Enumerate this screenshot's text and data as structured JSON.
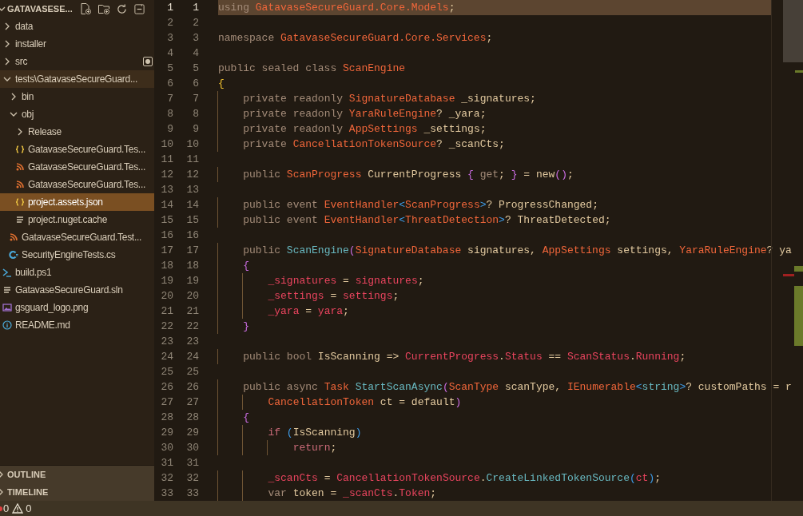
{
  "explorer": {
    "title": "GATAVASESE...",
    "expanded": true,
    "tree": [
      {
        "label": "data",
        "kind": "folder",
        "expanded": false,
        "selected": false,
        "hovered": false,
        "badge": false
      },
      {
        "label": "installer",
        "kind": "folder",
        "expanded": false,
        "selected": false,
        "hovered": false,
        "badge": false
      },
      {
        "label": "src",
        "kind": "folder",
        "expanded": false,
        "selected": false,
        "hovered": false,
        "badge": true
      },
      {
        "label": "tests\\GatavaseSecureGuard...",
        "kind": "folder",
        "expanded": true,
        "selected": false,
        "hovered": true,
        "badge": false,
        "children": [
          {
            "label": "bin",
            "kind": "folder",
            "expanded": false,
            "selected": false,
            "hovered": false,
            "badge": false
          },
          {
            "label": "obj",
            "kind": "folder",
            "expanded": true,
            "selected": false,
            "hovered": false,
            "badge": false,
            "children": [
              {
                "label": "Release",
                "kind": "folder",
                "expanded": false,
                "selected": false,
                "hovered": false,
                "badge": false
              },
              {
                "label": "GatavaseSecureGuard.Tes...",
                "kind": "json",
                "selected": false,
                "hovered": false,
                "badge": false
              },
              {
                "label": "GatavaseSecureGuard.Tes...",
                "kind": "feed",
                "selected": false,
                "hovered": false,
                "badge": false
              },
              {
                "label": "GatavaseSecureGuard.Tes...",
                "kind": "feed",
                "selected": false,
                "hovered": false,
                "badge": false
              },
              {
                "label": "project.assets.json",
                "kind": "json",
                "selected": true,
                "hovered": false,
                "badge": false
              },
              {
                "label": "project.nuget.cache",
                "kind": "text",
                "selected": false,
                "hovered": false,
                "badge": false
              }
            ]
          },
          {
            "label": "GatavaseSecureGuard.Test...",
            "kind": "feed",
            "selected": false,
            "hovered": false,
            "badge": false
          },
          {
            "label": "SecurityEngineTests.cs",
            "kind": "csharp",
            "selected": false,
            "hovered": false,
            "badge": false
          }
        ]
      },
      {
        "label": "build.ps1",
        "kind": "shell",
        "selected": false,
        "hovered": false,
        "badge": false
      },
      {
        "label": "GatavaseSecureGuard.sln",
        "kind": "text",
        "selected": false,
        "hovered": false,
        "badge": false
      },
      {
        "label": "gsguard_logo.png",
        "kind": "image",
        "selected": false,
        "hovered": false,
        "badge": false
      },
      {
        "label": "README.md",
        "kind": "info",
        "selected": false,
        "hovered": false,
        "badge": false
      }
    ]
  },
  "panels": [
    {
      "label": "OUTLINE",
      "expanded": false
    },
    {
      "label": "TIMELINE",
      "expanded": false
    }
  ],
  "editor": {
    "lines": [
      {
        "n": "1",
        "n2": "1",
        "current": true,
        "parts": [
          {
            "kind": "keyword",
            "text": "using "
          },
          {
            "kind": "type",
            "text": "GatavaseSecureGuard.Core.Models"
          },
          {
            "kind": "plain",
            "text": ";"
          }
        ]
      },
      {
        "n": "2",
        "n2": "2",
        "current": false
      },
      {
        "n": "3",
        "n2": "3",
        "current": false,
        "parts": [
          {
            "kind": "keyword",
            "text": "namespace "
          },
          {
            "kind": "type",
            "text": "GatavaseSecureGuard.Core.Services"
          },
          {
            "kind": "plain",
            "text": ";"
          }
        ]
      },
      {
        "n": "4",
        "n2": "4",
        "current": false
      },
      {
        "n": "5",
        "n2": "5",
        "current": false,
        "parts": [
          {
            "kind": "keyword",
            "text": "public sealed class "
          },
          {
            "kind": "type",
            "text": "ScanEngine"
          }
        ]
      },
      {
        "n": "6",
        "n2": "6",
        "current": false,
        "parts": [
          {
            "kind": "brace1",
            "text": "{"
          }
        ]
      },
      {
        "n": "7",
        "n2": "7",
        "current": false,
        "parts": [
          {
            "kind": "keyword",
            "text": "    private readonly "
          },
          {
            "kind": "type",
            "text": "SignatureDatabase"
          },
          {
            "kind": "plain",
            "text": " _signatures;"
          }
        ]
      },
      {
        "n": "8",
        "n2": "8",
        "current": false,
        "parts": [
          {
            "kind": "keyword",
            "text": "    private readonly "
          },
          {
            "kind": "type",
            "text": "YaraRuleEngine"
          },
          {
            "kind": "plain",
            "text": "? _yara;"
          }
        ]
      },
      {
        "n": "9",
        "n2": "9",
        "current": false,
        "parts": [
          {
            "kind": "keyword",
            "text": "    private readonly "
          },
          {
            "kind": "type",
            "text": "AppSettings"
          },
          {
            "kind": "plain",
            "text": " _settings;"
          }
        ]
      },
      {
        "n": "10",
        "n2": "10",
        "current": false,
        "parts": [
          {
            "kind": "keyword",
            "text": "    private "
          },
          {
            "kind": "type",
            "text": "CancellationTokenSource"
          },
          {
            "kind": "plain",
            "text": "? _scanCts;"
          }
        ]
      },
      {
        "n": "11",
        "n2": "11",
        "current": false
      },
      {
        "n": "12",
        "n2": "12",
        "current": false,
        "parts": [
          {
            "kind": "keyword",
            "text": "    public "
          },
          {
            "kind": "type",
            "text": "ScanProgress"
          },
          {
            "kind": "plain",
            "text": " CurrentProgress "
          },
          {
            "kind": "brace2",
            "text": "{"
          },
          {
            "kind": "keyword",
            "text": " get"
          },
          {
            "kind": "plain",
            "text": "; "
          },
          {
            "kind": "brace2",
            "text": "}"
          },
          {
            "kind": "plain",
            "text": " = new"
          },
          {
            "kind": "brace2",
            "text": "()"
          },
          {
            "kind": "plain",
            "text": ";"
          }
        ]
      },
      {
        "n": "13",
        "n2": "13",
        "current": false
      },
      {
        "n": "14",
        "n2": "14",
        "current": false,
        "parts": [
          {
            "kind": "keyword",
            "text": "    public event "
          },
          {
            "kind": "type",
            "text": "EventHandler"
          },
          {
            "kind": "brace3",
            "text": "<"
          },
          {
            "kind": "type",
            "text": "ScanProgress"
          },
          {
            "kind": "brace3",
            "text": ">"
          },
          {
            "kind": "plain",
            "text": "? ProgressChanged;"
          }
        ]
      },
      {
        "n": "15",
        "n2": "15",
        "current": false,
        "parts": [
          {
            "kind": "keyword",
            "text": "    public event "
          },
          {
            "kind": "type",
            "text": "EventHandler"
          },
          {
            "kind": "brace3",
            "text": "<"
          },
          {
            "kind": "type",
            "text": "ThreatDetection"
          },
          {
            "kind": "brace3",
            "text": ">"
          },
          {
            "kind": "plain",
            "text": "? ThreatDetected;"
          }
        ]
      },
      {
        "n": "16",
        "n2": "16",
        "current": false
      },
      {
        "n": "17",
        "n2": "17",
        "current": false,
        "parts": [
          {
            "kind": "keyword",
            "text": "    public "
          },
          {
            "kind": "function",
            "text": "ScanEngine"
          },
          {
            "kind": "brace2",
            "text": "("
          },
          {
            "kind": "type",
            "text": "SignatureDatabase"
          },
          {
            "kind": "plain",
            "text": " signatures, "
          },
          {
            "kind": "type",
            "text": "AppSettings"
          },
          {
            "kind": "plain",
            "text": " settings, "
          },
          {
            "kind": "type",
            "text": "YaraRuleEngine"
          },
          {
            "kind": "plain",
            "text": "? ya"
          }
        ]
      },
      {
        "n": "18",
        "n2": "18",
        "current": false,
        "parts": [
          {
            "kind": "brace2",
            "text": "    {"
          }
        ]
      },
      {
        "n": "19",
        "n2": "19",
        "current": false,
        "parts": [
          {
            "kind": "field",
            "text": "        _signatures "
          },
          {
            "kind": "plain",
            "text": "= "
          },
          {
            "kind": "field",
            "text": "signatures"
          },
          {
            "kind": "plain",
            "text": ";"
          }
        ]
      },
      {
        "n": "20",
        "n2": "20",
        "current": false,
        "parts": [
          {
            "kind": "field",
            "text": "        _settings "
          },
          {
            "kind": "plain",
            "text": "= "
          },
          {
            "kind": "field",
            "text": "settings"
          },
          {
            "kind": "plain",
            "text": ";"
          }
        ]
      },
      {
        "n": "21",
        "n2": "21",
        "current": false,
        "parts": [
          {
            "kind": "field",
            "text": "        _yara "
          },
          {
            "kind": "plain",
            "text": "= "
          },
          {
            "kind": "field",
            "text": "yara"
          },
          {
            "kind": "plain",
            "text": ";"
          }
        ]
      },
      {
        "n": "22",
        "n2": "22",
        "current": false,
        "parts": [
          {
            "kind": "brace2",
            "text": "    }"
          }
        ]
      },
      {
        "n": "23",
        "n2": "23",
        "current": false
      },
      {
        "n": "24",
        "n2": "24",
        "current": false,
        "parts": [
          {
            "kind": "keyword",
            "text": "    public bool "
          },
          {
            "kind": "plain",
            "text": "IsScanning => "
          },
          {
            "kind": "field",
            "text": "CurrentProgress"
          },
          {
            "kind": "plain",
            "text": "."
          },
          {
            "kind": "field",
            "text": "Status"
          },
          {
            "kind": "plain",
            "text": " == "
          },
          {
            "kind": "field",
            "text": "ScanStatus"
          },
          {
            "kind": "plain",
            "text": "."
          },
          {
            "kind": "field",
            "text": "Running"
          },
          {
            "kind": "plain",
            "text": ";"
          }
        ]
      },
      {
        "n": "25",
        "n2": "25",
        "current": false
      },
      {
        "n": "26",
        "n2": "26",
        "current": false,
        "parts": [
          {
            "kind": "keyword",
            "text": "    public async "
          },
          {
            "kind": "type",
            "text": "Task "
          },
          {
            "kind": "function",
            "text": "StartScanAsync"
          },
          {
            "kind": "brace2",
            "text": "("
          },
          {
            "kind": "type",
            "text": "ScanType"
          },
          {
            "kind": "plain",
            "text": " scanType, "
          },
          {
            "kind": "type",
            "text": "IEnumerable"
          },
          {
            "kind": "brace3",
            "text": "<"
          },
          {
            "kind": "function",
            "text": "string"
          },
          {
            "kind": "brace3",
            "text": ">"
          },
          {
            "kind": "plain",
            "text": "? customPaths = r"
          }
        ]
      },
      {
        "n": "27",
        "n2": "27",
        "current": false,
        "parts": [
          {
            "kind": "type",
            "text": "        CancellationToken"
          },
          {
            "kind": "plain",
            "text": " ct = default"
          },
          {
            "kind": "brace2",
            "text": ")"
          }
        ]
      },
      {
        "n": "28",
        "n2": "28",
        "current": false,
        "parts": [
          {
            "kind": "brace2",
            "text": "    {"
          }
        ]
      },
      {
        "n": "29",
        "n2": "29",
        "current": false,
        "parts": [
          {
            "kind": "control",
            "text": "        if "
          },
          {
            "kind": "brace3",
            "text": "("
          },
          {
            "kind": "plain",
            "text": "IsScanning"
          },
          {
            "kind": "brace3",
            "text": ")"
          }
        ]
      },
      {
        "n": "30",
        "n2": "30",
        "current": false,
        "parts": [
          {
            "kind": "control",
            "text": "            return"
          },
          {
            "kind": "plain",
            "text": ";"
          }
        ]
      },
      {
        "n": "31",
        "n2": "31",
        "current": false
      },
      {
        "n": "32",
        "n2": "32",
        "current": false,
        "parts": [
          {
            "kind": "field",
            "text": "        _scanCts "
          },
          {
            "kind": "plain",
            "text": "= "
          },
          {
            "kind": "field",
            "text": "CancellationTokenSource"
          },
          {
            "kind": "plain",
            "text": "."
          },
          {
            "kind": "function",
            "text": "CreateLinkedTokenSource"
          },
          {
            "kind": "brace3",
            "text": "("
          },
          {
            "kind": "field",
            "text": "ct"
          },
          {
            "kind": "brace3",
            "text": ")"
          },
          {
            "kind": "plain",
            "text": ";"
          }
        ]
      },
      {
        "n": "33",
        "n2": "33",
        "current": false,
        "parts": [
          {
            "kind": "keyword",
            "text": "        var "
          },
          {
            "kind": "plain",
            "text": "token = "
          },
          {
            "kind": "field",
            "text": "_scanCts"
          },
          {
            "kind": "plain",
            "text": "."
          },
          {
            "kind": "field",
            "text": "Token"
          },
          {
            "kind": "plain",
            "text": ";"
          }
        ]
      }
    ]
  },
  "status_bar": {
    "errors": "0",
    "warnings": "0"
  }
}
